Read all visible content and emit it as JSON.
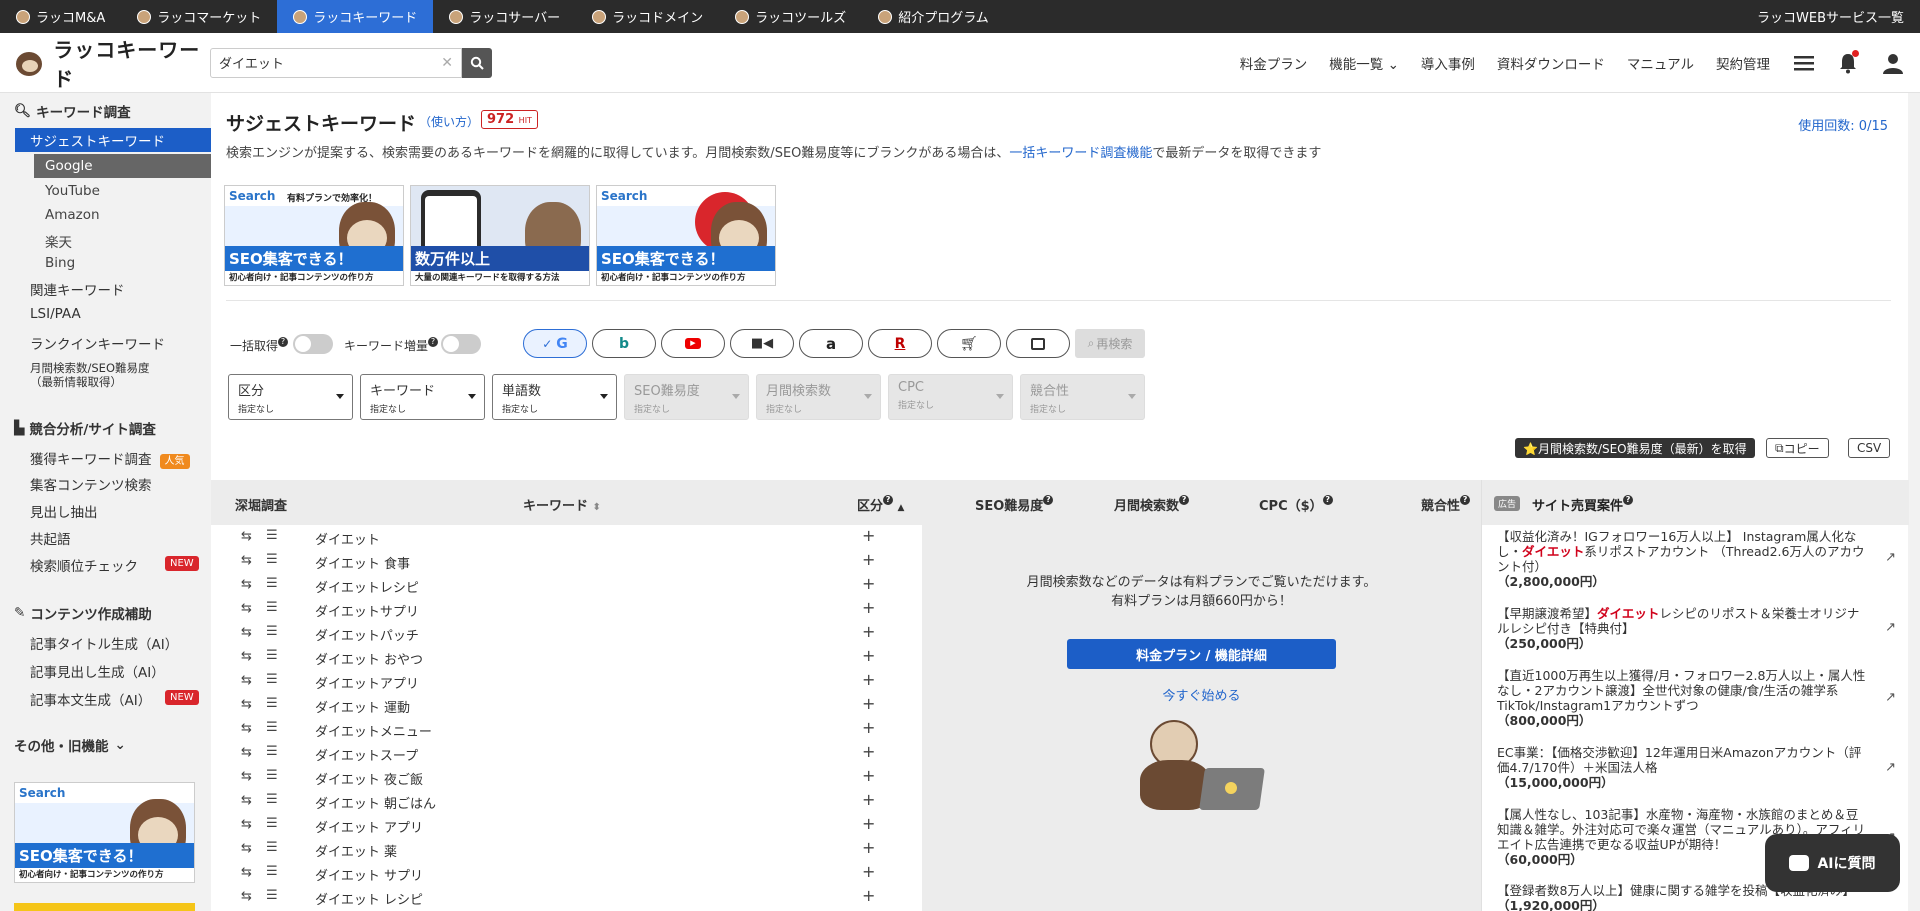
{
  "services": {
    "tabs": [
      {
        "label": "ラッコM&A"
      },
      {
        "label": "ラッコマーケット"
      },
      {
        "label": "ラッコキーワード"
      },
      {
        "label": "ラッコサーバー"
      },
      {
        "label": "ラッコドメイン"
      },
      {
        "label": "ラッコツールズ"
      },
      {
        "label": "紹介プログラム"
      }
    ],
    "right_label": "ラッコWEBサービス一覧"
  },
  "header": {
    "logo_text": "ラッコキーワード",
    "search_value": "ダイエット",
    "nav": [
      "料金プラン",
      "機能一覧",
      "導入事例",
      "資料ダウンロード",
      "マニュアル",
      "契約管理"
    ]
  },
  "sidebar": {
    "sec_keyword": "キーワード調査",
    "suggest": "サジェストキーワード",
    "sub": [
      "Google",
      "YouTube",
      "Amazon",
      "楽天",
      "Bing"
    ],
    "items1": [
      "関連キーワード",
      "LSI/PAA",
      "ランクインキーワード"
    ],
    "monthly_line1": "月間検索数/SEO難易度",
    "monthly_line2": "（最新情報取得）",
    "sec_competitor": "競合分析/サイト調査",
    "acquired": "獲得キーワード調査",
    "popular_badge": "人気",
    "content_search": "集客コンテンツ検索",
    "heading_extract": "見出し抽出",
    "co_occur": "共起語",
    "rank_check": "検索順位チェック",
    "new_badge": "NEW",
    "sec_content": "コンテンツ作成補助",
    "title_gen": "記事タイトル生成（AI）",
    "heading_gen": "記事見出し生成（AI）",
    "body_gen": "記事本文生成（AI）",
    "sec_other": "その他・旧機能"
  },
  "main": {
    "title": "サジェストキーワード",
    "howto": "（使い方）",
    "hit_count": "972",
    "hit_unit": "HIT",
    "usage": "使用回数: 0/15",
    "desc_before": "検索エンジンが提案する、検索需要のあるキーワードを網羅的に取得しています。月間検索数/SEO難易度等にブランクがある場合は、",
    "desc_link": "一括キーワード調査機能",
    "desc_after": "で最新データを取得できます",
    "banners": [
      {
        "search": "Search",
        "catch": "有料プランで効率化！",
        "big": "SEO集客できる！",
        "small": "初心者向け・記事コンテンツの作り方"
      },
      {
        "search": "",
        "catch": "",
        "big": "数万件以上",
        "small": "大量の関連キーワードを取得する方法"
      },
      {
        "search": "Search",
        "catch": "",
        "big": "SEO集客できる！",
        "small": "初心者向け・記事コンテンツの作り方"
      }
    ],
    "toggle_bulk": "一括取得",
    "toggle_increase": "キーワード増量",
    "research": "再検索",
    "filters": [
      {
        "name": "区分",
        "sub": "指定なし",
        "disabled": false
      },
      {
        "name": "キーワード",
        "sub": "指定なし",
        "disabled": false
      },
      {
        "name": "単語数",
        "sub": "指定なし",
        "disabled": false
      },
      {
        "name": "SEO難易度",
        "sub": "指定なし",
        "disabled": true
      },
      {
        "name": "月間検索数",
        "sub": "指定なし",
        "disabled": true
      },
      {
        "name": "CPC",
        "sub": "指定なし",
        "disabled": true
      },
      {
        "name": "競合性",
        "sub": "指定なし",
        "disabled": true
      }
    ],
    "fetch_btn": "⭐月間検索数/SEO難易度（最新）を取得",
    "copy_btn": "コピー",
    "csv_btn": "CSV"
  },
  "table": {
    "headers": {
      "deep": "深堀調査",
      "keyword": "キーワード",
      "kubun": "区分",
      "seo": "SEO難易度",
      "monthly": "月間検索数",
      "cpc": "CPC（$）",
      "competition": "競合性"
    },
    "rows": [
      "ダイエット",
      "ダイエット 食事",
      "ダイエットレシピ",
      "ダイエットサプリ",
      "ダイエットパッチ",
      "ダイエット おやつ",
      "ダイエットアプリ",
      "ダイエット 運動",
      "ダイエットメニュー",
      "ダイエットスープ",
      "ダイエット 夜ご飯",
      "ダイエット 朝ごはん",
      "ダイエット アプリ",
      "ダイエット 薬",
      "ダイエット サプリ",
      "ダイエット レシピ"
    ]
  },
  "paywall": {
    "line1": "月間検索数などのデータは有料プランでご覧いただけます。",
    "line2": "有料プランは月額660円から！",
    "button": "料金プラン / 機能詳細",
    "link": "今すぐ始める"
  },
  "ads": {
    "tag": "広告",
    "title": "サイト売買案件",
    "items": [
      {
        "pre": "【収益化済み！IGフォロワー16万人以上】 Instagram属人化なし・",
        "hl": "ダイエット",
        "post": "系リポストアカウント （Thread2.6万人のアカウント付）",
        "price": "（2,800,000円）"
      },
      {
        "pre": "【早期譲渡希望】",
        "hl": "ダイエット",
        "post": "レシピのリポスト＆栄養士オリジナルレシピ付き【特典付】",
        "price": "（250,000円）"
      },
      {
        "pre": "【直近1000万再生以上獲得/月・フォロワー2.8万人以上・属人性なし・2アカウント譲渡】全世代対象の健康/食/生活の雑学系TikTok/Instagram1アカウントずつ",
        "hl": "",
        "post": "",
        "price": "（800,000円）"
      },
      {
        "pre": "EC事業：【価格交渉歓迎】12年運用日米Amazonアカウント（評価4.7/170件）＋米国法人格",
        "hl": "",
        "post": "",
        "price": "（15,000,000円）"
      },
      {
        "pre": "【属人性なし、103記事】水産物・海産物・水族館のまとめ＆豆知識＆雑学。外注対応可で楽々運営（マニュアルあり）。アフィリエイト広告連携で更なる収益UPが期待！",
        "hl": "",
        "post": "",
        "price": "（60,000円）"
      },
      {
        "pre": "【登録者数8万人以上】健康に関する雑学を投稿【収益化済み】",
        "hl": "",
        "post": "",
        "price": "（1,920,000円）"
      }
    ]
  },
  "ai_button": "AIに質問"
}
